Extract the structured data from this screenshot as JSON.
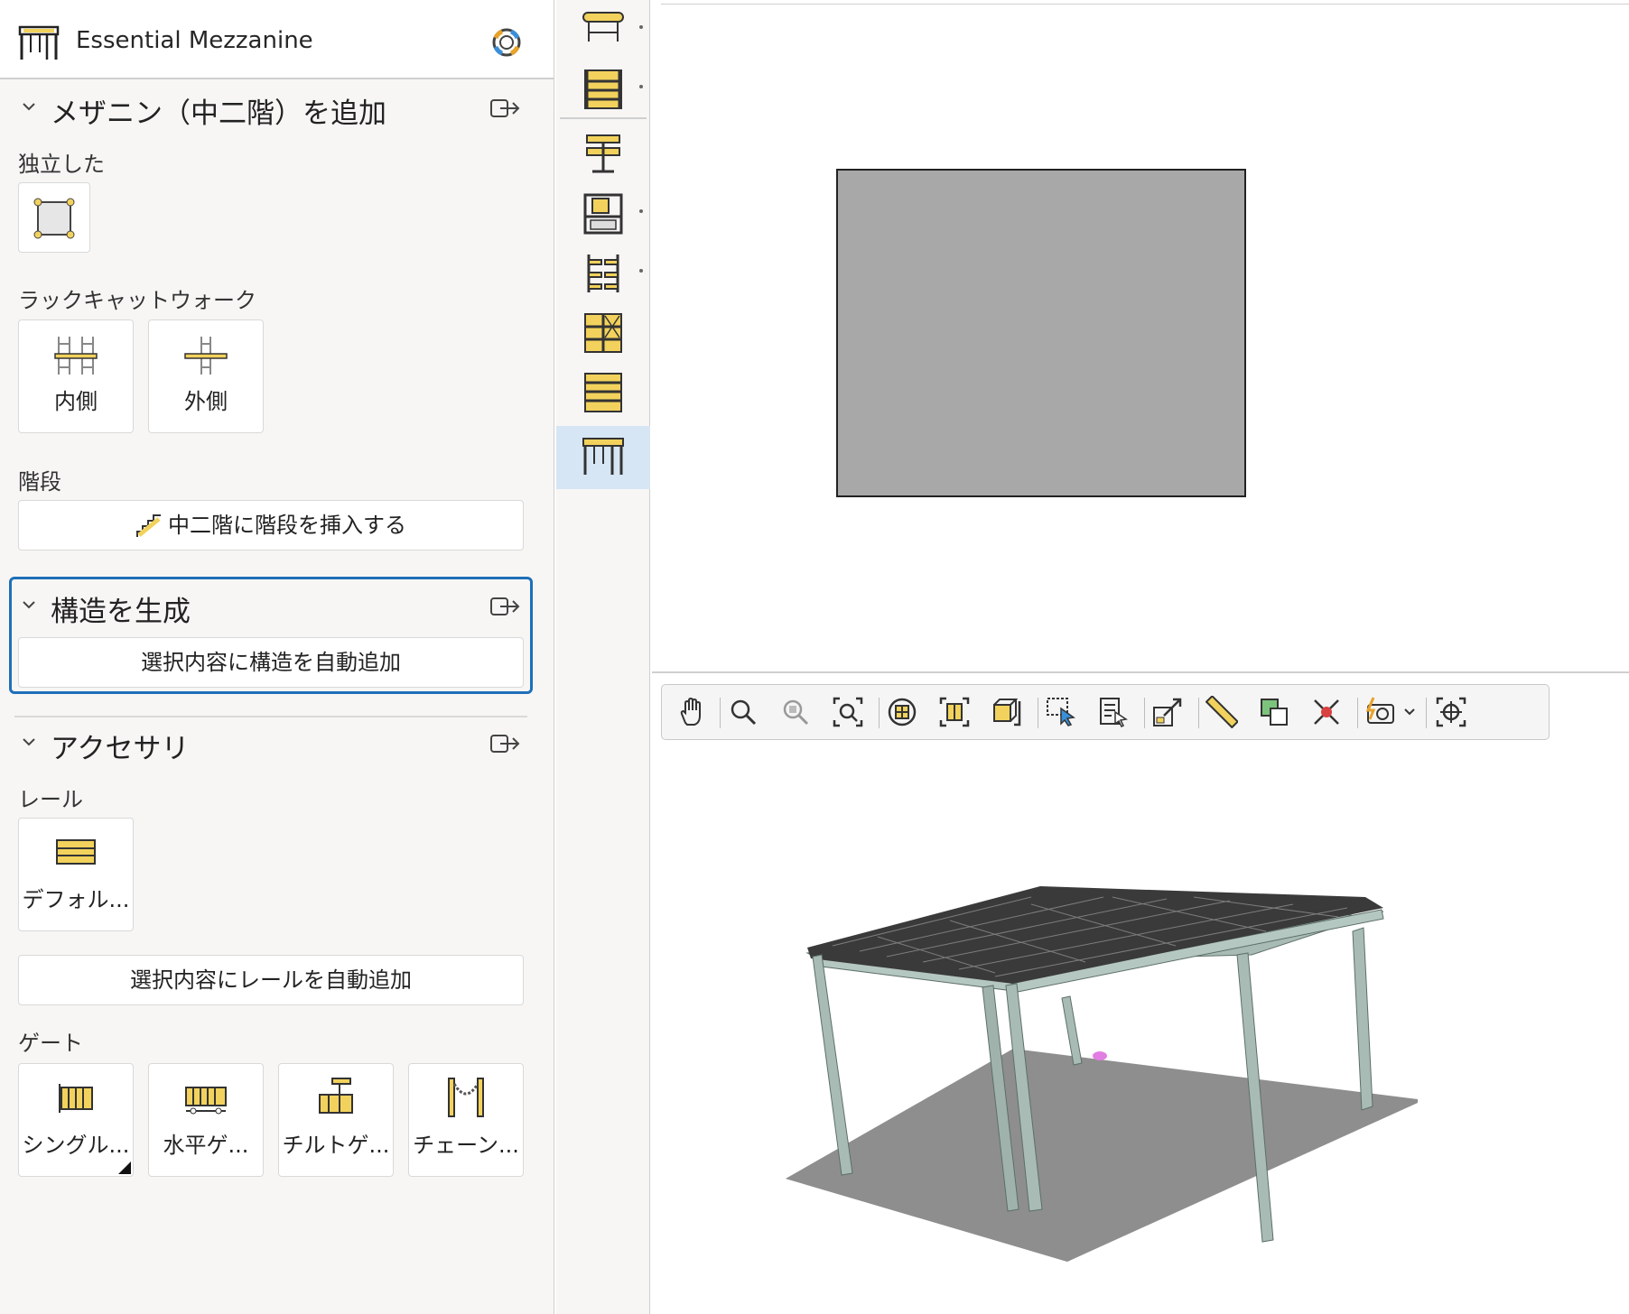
{
  "app": {
    "title": "Essential Mezzanine"
  },
  "sections": {
    "add_mezzanine": {
      "title": "メザニン（中二階）を追加",
      "standalone_label": "独立した",
      "rack_catwalk_label": "ラックキャットウォーク",
      "rack_tiles": [
        "内側",
        "外側"
      ],
      "stairs_label": "階段",
      "stairs_button": "中二階に階段を挿入する"
    },
    "generate_structure": {
      "title": "構造を生成",
      "auto_add_button": "選択内容に構造を自動追加"
    },
    "accessories": {
      "title": "アクセサリ",
      "rail_label": "レール",
      "rail_tile": "デフォル...",
      "rail_auto_button": "選択内容にレールを自動追加",
      "gate_label": "ゲート",
      "gate_tiles": [
        "シングル...",
        "水平ゲ...",
        "チルトゲ...",
        "チェーン..."
      ]
    }
  },
  "icon_strip": {
    "items": [
      "conveyor-icon",
      "pallet-rack-icon",
      "stacker-crane-icon",
      "carton-flow-icon",
      "cantilever-rack-icon",
      "drive-in-rack-icon",
      "shelving-icon",
      "mezzanine-icon"
    ],
    "active": "mezzanine-icon"
  },
  "toolbar": {
    "buttons": [
      "pan-icon",
      "zoom-icon",
      "zoom-region-icon",
      "zoom-fit-icon",
      "view-center-icon",
      "view-front-icon",
      "view-side-icon",
      "select-box-icon",
      "select-list-icon",
      "move-icon",
      "measure-icon",
      "copy-icon",
      "delete-icon",
      "snapshot-icon",
      "target-icon"
    ]
  },
  "colors": {
    "accent": "#1f6fb8",
    "active_strip": "#d7e6f4",
    "plan_fill": "#a8a8a8",
    "floor": "#8e8e8e",
    "column": "#a8bcb5",
    "grating": "#3a3a3a",
    "icon_yellow": "#f2d25c"
  }
}
